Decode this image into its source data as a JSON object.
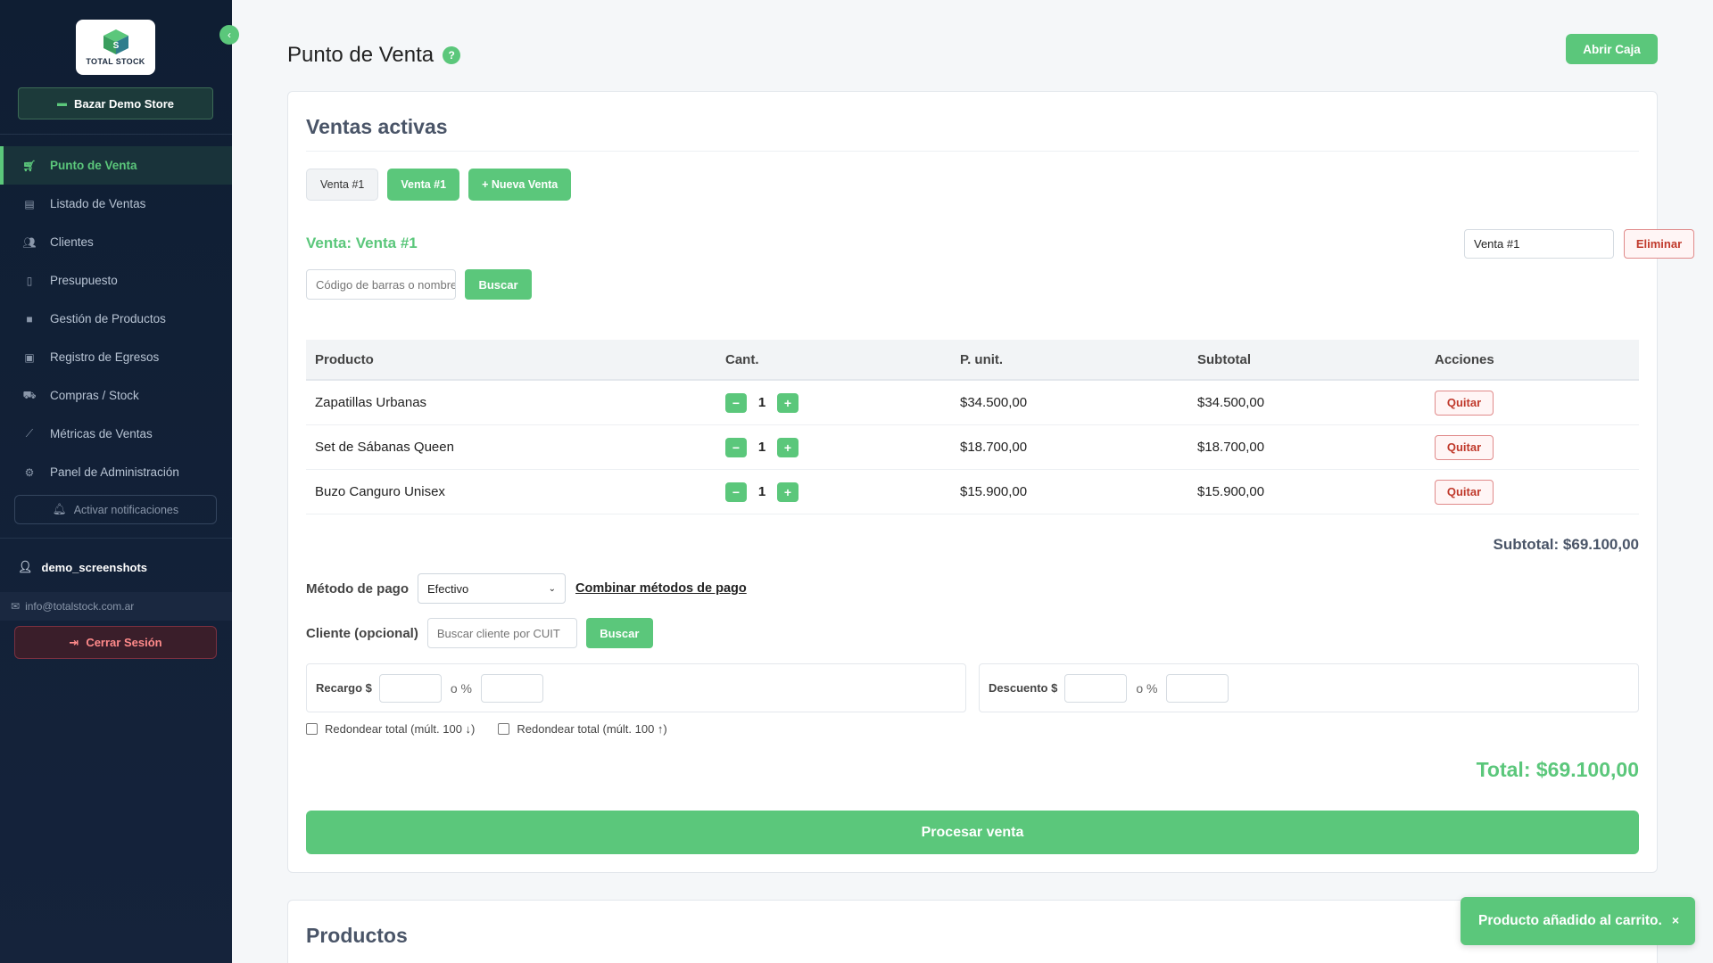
{
  "sidebar": {
    "logo_text": "TOTAL STOCK",
    "store_label": "Bazar Demo Store",
    "items": [
      {
        "label": "Punto de Venta",
        "icon": "cart-icon"
      },
      {
        "label": "Listado de Ventas",
        "icon": "list-icon"
      },
      {
        "label": "Clientes",
        "icon": "users-icon"
      },
      {
        "label": "Presupuesto",
        "icon": "file-icon"
      },
      {
        "label": "Gestión de Productos",
        "icon": "box-icon"
      },
      {
        "label": "Registro de Egresos",
        "icon": "money-icon"
      },
      {
        "label": "Compras / Stock",
        "icon": "truck-icon"
      },
      {
        "label": "Métricas de Ventas",
        "icon": "chart-icon"
      },
      {
        "label": "Panel de Administración",
        "icon": "gear-icon"
      }
    ],
    "notifications_label": "Activar notificaciones",
    "username": "demo_screenshots",
    "email": "info@totalstock.com.ar",
    "logout_label": "Cerrar Sesión"
  },
  "header": {
    "title": "Punto de Venta",
    "help": "?",
    "open_box_label": "Abrir Caja"
  },
  "sales": {
    "title": "Ventas activas",
    "tabs": [
      "Venta #1",
      "Venta #1",
      "+ Nueva Venta"
    ],
    "current_heading": "Venta: Venta #1",
    "sale_name_value": "Venta #1",
    "delete_label": "Eliminar",
    "barcode_placeholder": "Código de barras o nombre",
    "search_label": "Buscar"
  },
  "table": {
    "headers": [
      "Producto",
      "Cant.",
      "P. unit.",
      "Subtotal",
      "Acciones"
    ],
    "rows": [
      {
        "product": "Zapatillas Urbanas",
        "qty": "1",
        "unit": "$34.500,00",
        "subtotal": "$34.500,00"
      },
      {
        "product": "Set de Sábanas Queen",
        "qty": "1",
        "unit": "$18.700,00",
        "subtotal": "$18.700,00"
      },
      {
        "product": "Buzo Canguro Unisex",
        "qty": "1",
        "unit": "$15.900,00",
        "subtotal": "$15.900,00"
      }
    ],
    "remove_label": "Quitar",
    "minus": "−",
    "plus": "+"
  },
  "summary": {
    "subtotal": "Subtotal: $69.100,00",
    "payment_label": "Método de pago",
    "payment_value": "Efectivo",
    "combine_label": "Combinar métodos de pago",
    "client_label": "Cliente (opcional)",
    "client_placeholder": "Buscar cliente por CUIT",
    "client_search_label": "Buscar",
    "surcharge_label": "Recargo $",
    "discount_label": "Descuento $",
    "or_percent": "o %",
    "round_down": "Redondear total (múlt. 100 ↓)",
    "round_up": "Redondear total (múlt. 100 ↑)",
    "total": "Total: $69.100,00",
    "process_label": "Procesar venta"
  },
  "products": {
    "title": "Productos"
  },
  "toast": {
    "message": "Producto añadido al carrito.",
    "close": "×"
  },
  "colors": {
    "accent": "#5bc77b",
    "sidebar": "#0f1e33",
    "danger": "#c0392b"
  }
}
